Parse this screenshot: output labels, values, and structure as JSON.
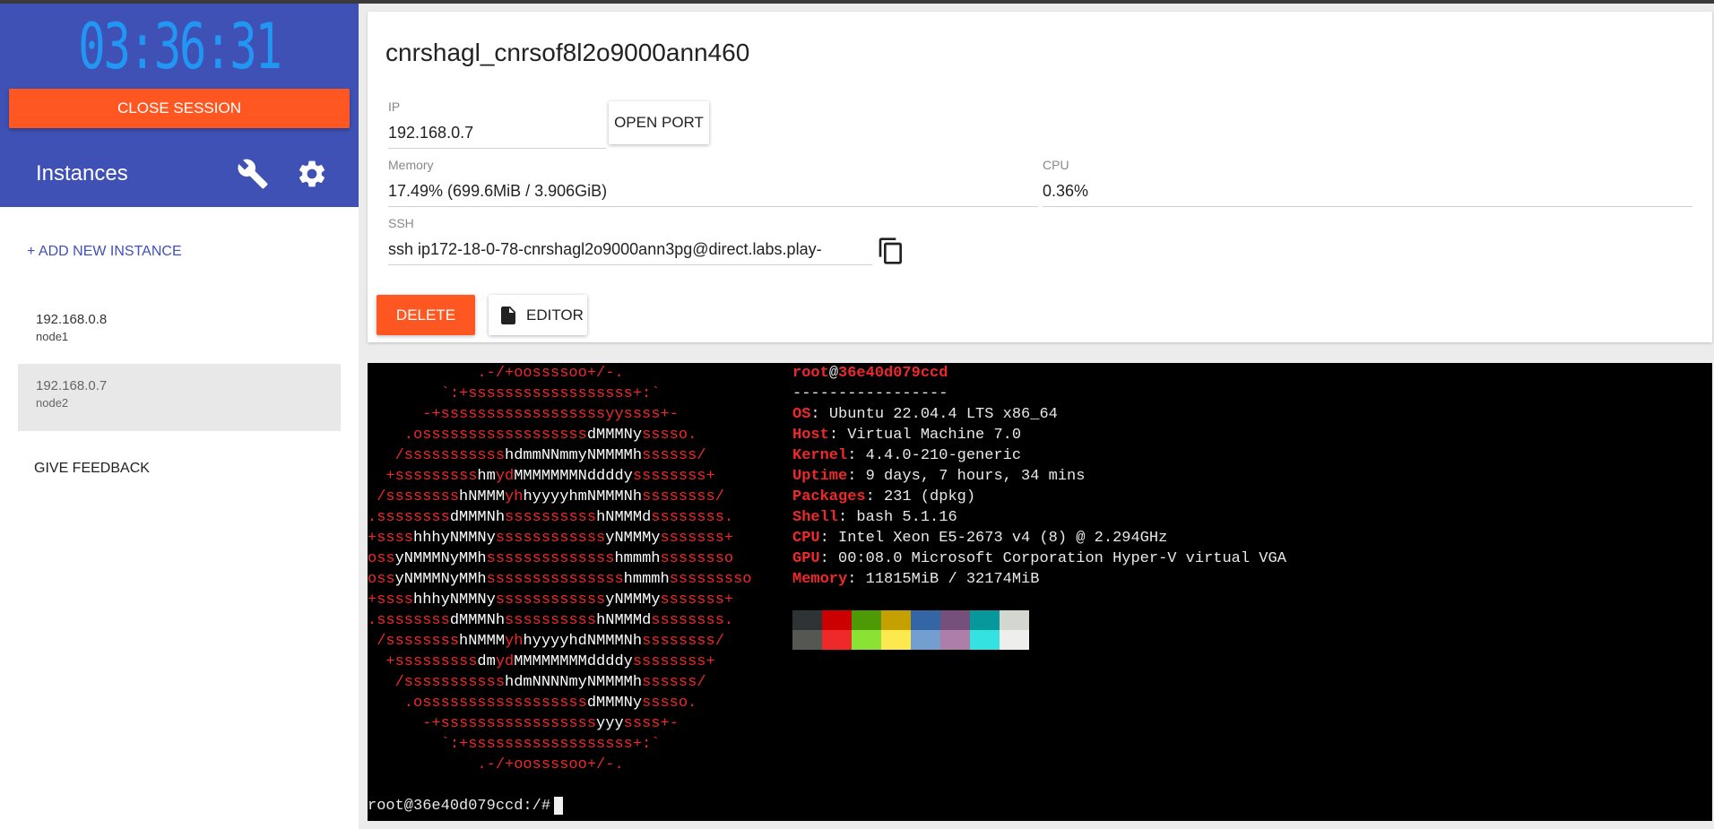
{
  "session": {
    "timer": "03:36:31",
    "close_label": "CLOSE SESSION"
  },
  "sidebar": {
    "title": "Instances",
    "add_instance_label": "+ ADD NEW INSTANCE",
    "settings_icon": "wrench-icon",
    "config_icon": "gear-icon",
    "nodes": [
      {
        "ip": "192.168.0.8",
        "name": "node1"
      },
      {
        "ip": "192.168.0.7",
        "name": "node2"
      }
    ],
    "feedback_label": "GIVE FEEDBACK"
  },
  "instance": {
    "title": "cnrshagl_cnrsof8l2o9000ann460",
    "ip_label": "IP",
    "ip_value": "192.168.0.7",
    "open_port_label": "OPEN PORT",
    "memory_label": "Memory",
    "memory_value": "17.49% (699.6MiB / 3.906GiB)",
    "cpu_label": "CPU",
    "cpu_value": "0.36%",
    "ssh_label": "SSH",
    "ssh_value": "ssh ip172-18-0-78-cnrshagl2o9000ann3pg@direct.labs.play-",
    "copy_icon": "copy-icon",
    "delete_label": "DELETE",
    "editor_label": "EDITOR",
    "editor_icon": "file-icon"
  },
  "terminal": {
    "ascii": [
      [
        [
          "            .-/+oossssoo+/-.",
          "r"
        ]
      ],
      [
        [
          "        `:+ssssssssssssssssss+:`",
          "r"
        ]
      ],
      [
        [
          "      -+ssssssssssssssssssyyssss+-",
          "r"
        ]
      ],
      [
        [
          "    .ossssssssssssssssss",
          "r"
        ],
        [
          "dMMMNy",
          "w"
        ],
        [
          "sssso.",
          "r"
        ]
      ],
      [
        [
          "   /sssssssssss",
          "r"
        ],
        [
          "hdmmNNmmyNMMMMh",
          "w"
        ],
        [
          "ssssss/",
          "r"
        ]
      ],
      [
        [
          "  +sssssssss",
          "r"
        ],
        [
          "hm",
          "w"
        ],
        [
          "yd",
          "r"
        ],
        [
          "MMMMMMMNddddy",
          "w"
        ],
        [
          "ssssssss+",
          "r"
        ]
      ],
      [
        [
          " /ssssssss",
          "r"
        ],
        [
          "hNMMM",
          "w"
        ],
        [
          "yh",
          "r"
        ],
        [
          "hyyyyhmNMMMNh",
          "w"
        ],
        [
          "ssssssss/",
          "r"
        ]
      ],
      [
        [
          ".ssssssss",
          "r"
        ],
        [
          "dMMMNh",
          "w"
        ],
        [
          "ssssssssss",
          "r"
        ],
        [
          "hNMMMd",
          "w"
        ],
        [
          "ssssssss.",
          "r"
        ]
      ],
      [
        [
          "+ssss",
          "r"
        ],
        [
          "hhhyNMMNy",
          "w"
        ],
        [
          "ssssssssssss",
          "r"
        ],
        [
          "yNMMMy",
          "w"
        ],
        [
          "sssssss+",
          "r"
        ]
      ],
      [
        [
          "oss",
          "r"
        ],
        [
          "yNMMMNyMMh",
          "w"
        ],
        [
          "ssssssssssssss",
          "r"
        ],
        [
          "hmmmh",
          "w"
        ],
        [
          "ssssssso",
          "r"
        ]
      ],
      [
        [
          "oss",
          "r"
        ],
        [
          "yNMMMNyMMh",
          "w"
        ],
        [
          "sssssssssssssss",
          "r"
        ],
        [
          "hmmmh",
          "w"
        ],
        [
          "sssssssso",
          "r"
        ]
      ],
      [
        [
          "+ssss",
          "r"
        ],
        [
          "hhhyNMMNy",
          "w"
        ],
        [
          "ssssssssssss",
          "r"
        ],
        [
          "yNMMMy",
          "w"
        ],
        [
          "sssssss+",
          "r"
        ]
      ],
      [
        [
          ".ssssssss",
          "r"
        ],
        [
          "dMMMNh",
          "w"
        ],
        [
          "ssssssssss",
          "r"
        ],
        [
          "hNMMMd",
          "w"
        ],
        [
          "ssssssss.",
          "r"
        ]
      ],
      [
        [
          " /ssssssss",
          "r"
        ],
        [
          "hNMMM",
          "w"
        ],
        [
          "yh",
          "r"
        ],
        [
          "hyyyyhdNMMMNh",
          "w"
        ],
        [
          "ssssssss/",
          "r"
        ]
      ],
      [
        [
          "  +sssssssss",
          "r"
        ],
        [
          "dm",
          "w"
        ],
        [
          "yd",
          "r"
        ],
        [
          "MMMMMMMMddddy",
          "w"
        ],
        [
          "ssssssss+",
          "r"
        ]
      ],
      [
        [
          "   /sssssssssss",
          "r"
        ],
        [
          "hdmNNNNmyNMMMMh",
          "w"
        ],
        [
          "ssssss/",
          "r"
        ]
      ],
      [
        [
          "    .ossssssssssssssssss",
          "r"
        ],
        [
          "dMMMNy",
          "w"
        ],
        [
          "sssso.",
          "r"
        ]
      ],
      [
        [
          "      -+sssssssssssssssss",
          "r"
        ],
        [
          "yyy",
          "w"
        ],
        [
          "ssss+-",
          "r"
        ]
      ],
      [
        [
          "        `:+ssssssssssssssssss+:`",
          "r"
        ]
      ],
      [
        [
          "            .-/+oossssoo+/-.",
          "r"
        ]
      ]
    ],
    "user_host": "root",
    "host": "36e40d079ccd",
    "separator": "-----------------",
    "info": [
      {
        "key": "OS",
        "value": "Ubuntu 22.04.4 LTS x86_64"
      },
      {
        "key": "Host",
        "value": "Virtual Machine 7.0"
      },
      {
        "key": "Kernel",
        "value": "4.4.0-210-generic"
      },
      {
        "key": "Uptime",
        "value": "9 days, 7 hours, 34 mins"
      },
      {
        "key": "Packages",
        "value": "231 (dpkg)"
      },
      {
        "key": "Shell",
        "value": "bash 5.1.16"
      },
      {
        "key": "CPU",
        "value": "Intel Xeon E5-2673 v4 (8) @ 2.294GHz"
      },
      {
        "key": "GPU",
        "value": "00:08.0 Microsoft Corporation Hyper-V virtual VGA"
      },
      {
        "key": "Memory",
        "value": "11815MiB / 32174MiB"
      }
    ],
    "palette_top": [
      "#2e3436",
      "#cc0000",
      "#4e9a06",
      "#c4a000",
      "#3465a4",
      "#75507b",
      "#06989a",
      "#d3d7cf"
    ],
    "palette_bottom": [
      "#555753",
      "#ef2929",
      "#8ae234",
      "#fce94f",
      "#729fcf",
      "#ad7fa8",
      "#34e2e2",
      "#eeeeec"
    ],
    "prompt": "root@36e40d079ccd:/#"
  }
}
